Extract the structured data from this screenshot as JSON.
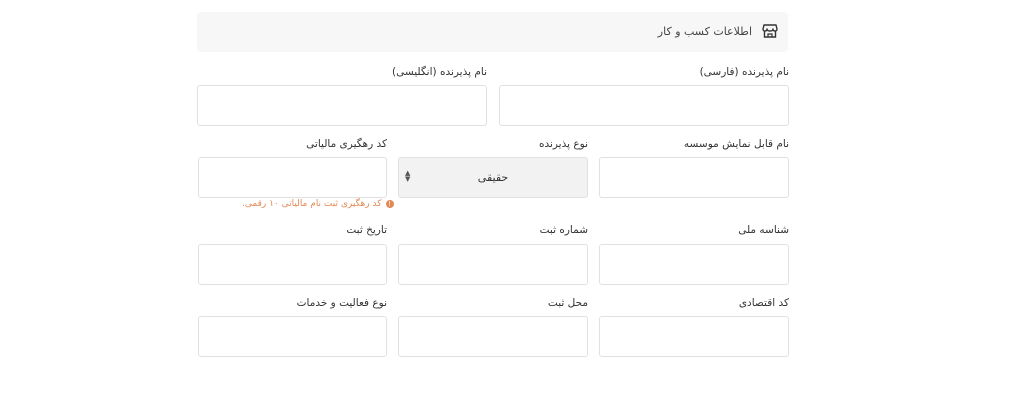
{
  "section": {
    "title": "اطلاعات کسب و کار",
    "icon": "store-icon"
  },
  "fields": {
    "merchant_name_fa": {
      "label": "نام پذیرنده (فارسی)",
      "value": ""
    },
    "merchant_name_en": {
      "label": "نام پذیرنده (انگلیسی)",
      "value": ""
    },
    "display_name": {
      "label": "نام قابل نمایش موسسه",
      "value": ""
    },
    "merchant_type": {
      "label": "نوع پذیرنده",
      "value": "حقیقی"
    },
    "tax_tracking_code": {
      "label": "کد رهگیری مالیاتی",
      "value": "",
      "hint": "کد رهگیری ثبت نام مالیاتی ۱۰ رقمی."
    },
    "national_id": {
      "label": "شناسه ملی",
      "value": ""
    },
    "registration_number": {
      "label": "شماره ثبت",
      "value": ""
    },
    "registration_date": {
      "label": "تاریخ ثبت",
      "value": ""
    },
    "economic_code": {
      "label": "کد اقتصادی",
      "value": ""
    },
    "registration_place": {
      "label": "محل ثبت",
      "value": ""
    },
    "activity_type": {
      "label": "نوع فعالیت و خدمات",
      "value": ""
    }
  },
  "colors": {
    "hint": "#e08a55",
    "border": "#e1e1e1",
    "header_bg": "#f7f7f7"
  }
}
